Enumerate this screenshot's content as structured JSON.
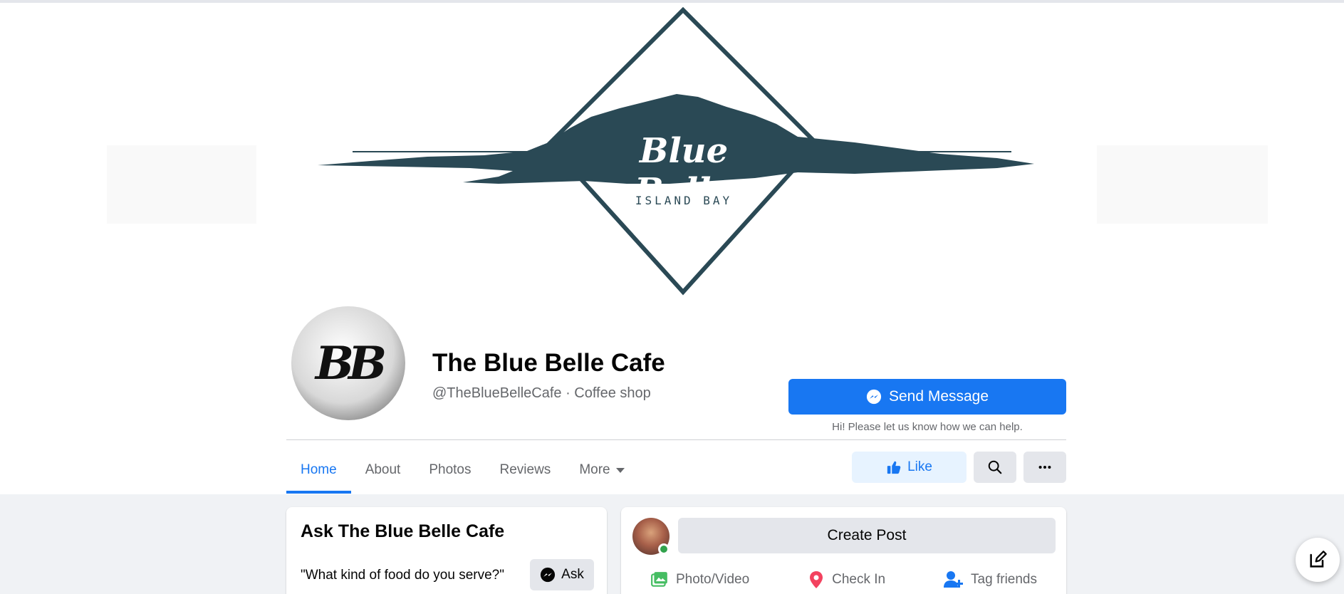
{
  "cover": {
    "brand_name": "Blue Belle",
    "brand_subtitle": "ISLAND BAY"
  },
  "profile": {
    "avatar_monogram": "BB",
    "name": "The Blue Belle Cafe",
    "handle_line": "@TheBlueBelleCafe · Coffee shop"
  },
  "actions": {
    "send_message_label": "Send Message",
    "send_message_help": "Hi! Please let us know how we can help.",
    "like_label": "Like"
  },
  "tabs": [
    {
      "label": "Home",
      "active": true
    },
    {
      "label": "About"
    },
    {
      "label": "Photos"
    },
    {
      "label": "Reviews"
    },
    {
      "label": "More"
    }
  ],
  "ask_card": {
    "title": "Ask The Blue Belle Cafe",
    "question": "\"What kind of food do you serve?\"",
    "ask_label": "Ask"
  },
  "post_card": {
    "create_post_label": "Create Post",
    "actions": [
      {
        "label": "Photo/Video",
        "icon": "photo-video-icon"
      },
      {
        "label": "Check In",
        "icon": "location-pin-icon"
      },
      {
        "label": "Tag friends",
        "icon": "tag-friends-icon"
      }
    ]
  },
  "colors": {
    "accent": "#1877f2",
    "brand_dark": "#2a4955",
    "background": "#f0f2f5"
  }
}
